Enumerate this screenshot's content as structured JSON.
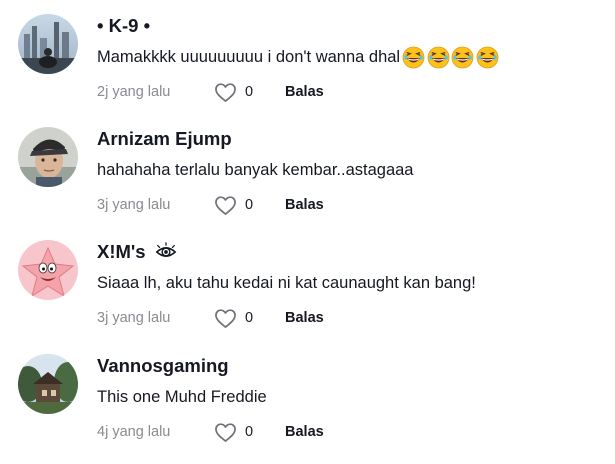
{
  "comments": [
    {
      "username": "• K-9 •",
      "avatar": "avatar-city-skyline",
      "text": "Mamakkkk uuuuuuuuu i don't wanna dhal",
      "emojis": [
        "laughing-face-icon",
        "laughing-face-icon",
        "laughing-face-icon",
        "laughing-face-icon"
      ],
      "time": "2j yang lalu",
      "likes": "0",
      "reply_label": "Balas"
    },
    {
      "username": "Arnizam Ejump",
      "avatar": "avatar-person-cap",
      "text": "hahahaha terlalu banyak kembar..astagaaa",
      "time": "3j yang lalu",
      "likes": "0",
      "reply_label": "Balas"
    },
    {
      "username": "X!M's",
      "username_icon": "eye-icon",
      "avatar": "avatar-starfish-cartoon",
      "text": "Siaaa lh, aku tahu kedai ni kat caunaught kan bang!",
      "time": "3j yang lalu",
      "likes": "0",
      "reply_label": "Balas"
    },
    {
      "username": "Vannosgaming",
      "avatar": "avatar-house-trees",
      "text": "This one Muhd Freddie",
      "time": "4j yang lalu",
      "likes": "0",
      "reply_label": "Balas"
    }
  ],
  "colors": {
    "text_primary": "#161823",
    "text_secondary": "#8a8b91",
    "background": "#ffffff"
  }
}
